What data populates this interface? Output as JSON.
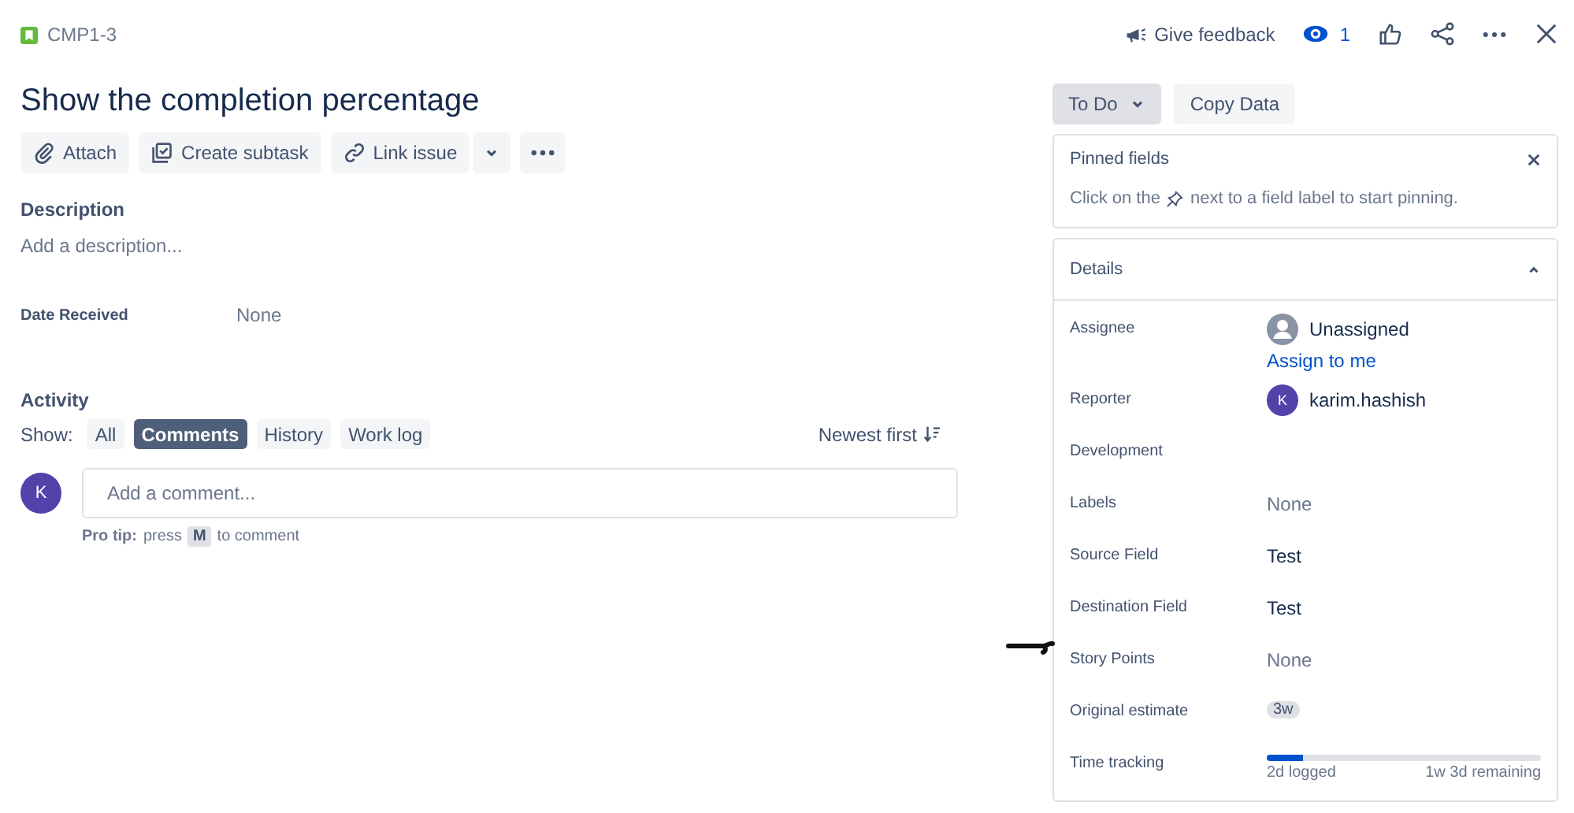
{
  "issue_key": "CMP1-3",
  "title": "Show the completion percentage",
  "actions": [
    "Attach",
    "Create subtask",
    "Link issue"
  ],
  "header": {
    "feedback": "Give feedback",
    "watchers": "1"
  },
  "description": {
    "label": "Description",
    "placeholder": "Add a description..."
  },
  "custom_fields": [
    {
      "label": "Date Received",
      "value": "None"
    }
  ],
  "activity": {
    "title": "Activity",
    "show_label": "Show:",
    "filters": [
      {
        "label": "All",
        "selected": false
      },
      {
        "label": "Comments",
        "selected": true
      },
      {
        "label": "History",
        "selected": false
      },
      {
        "label": "Work log",
        "selected": false
      }
    ],
    "sort": "Newest first",
    "avatar": "K",
    "comment_placeholder": "Add a comment...",
    "tip_bold": "Pro tip:",
    "tip_pre": "press",
    "tip_key": "M",
    "tip_post": "to comment"
  },
  "status": "To Do",
  "copy_data": "Copy Data",
  "pinned": {
    "title": "Pinned fields",
    "text_pre": "Click on the",
    "text_post": "next to a field label to start pinning."
  },
  "details": {
    "title": "Details",
    "expanded": true,
    "fields": [
      {
        "label": "Assignee",
        "kind": "assignee",
        "value": "Unassigned",
        "link": "Assign to me"
      },
      {
        "label": "Reporter",
        "kind": "user",
        "value": "karim.hashish",
        "avatar": "K"
      },
      {
        "label": "Development",
        "kind": "empty"
      },
      {
        "label": "Labels",
        "kind": "none",
        "value": "None"
      },
      {
        "label": "Source Field",
        "kind": "text",
        "value": "Test"
      },
      {
        "label": "Destination Field",
        "kind": "text",
        "value": "Test"
      },
      {
        "label": "Story Points",
        "kind": "none",
        "value": "None"
      },
      {
        "label": "Original estimate",
        "kind": "tag",
        "value": "3w"
      },
      {
        "label": "Time tracking",
        "kind": "progress",
        "level": 0.13,
        "logged": "2d logged",
        "remaining": "1w 3d remaining"
      }
    ]
  }
}
